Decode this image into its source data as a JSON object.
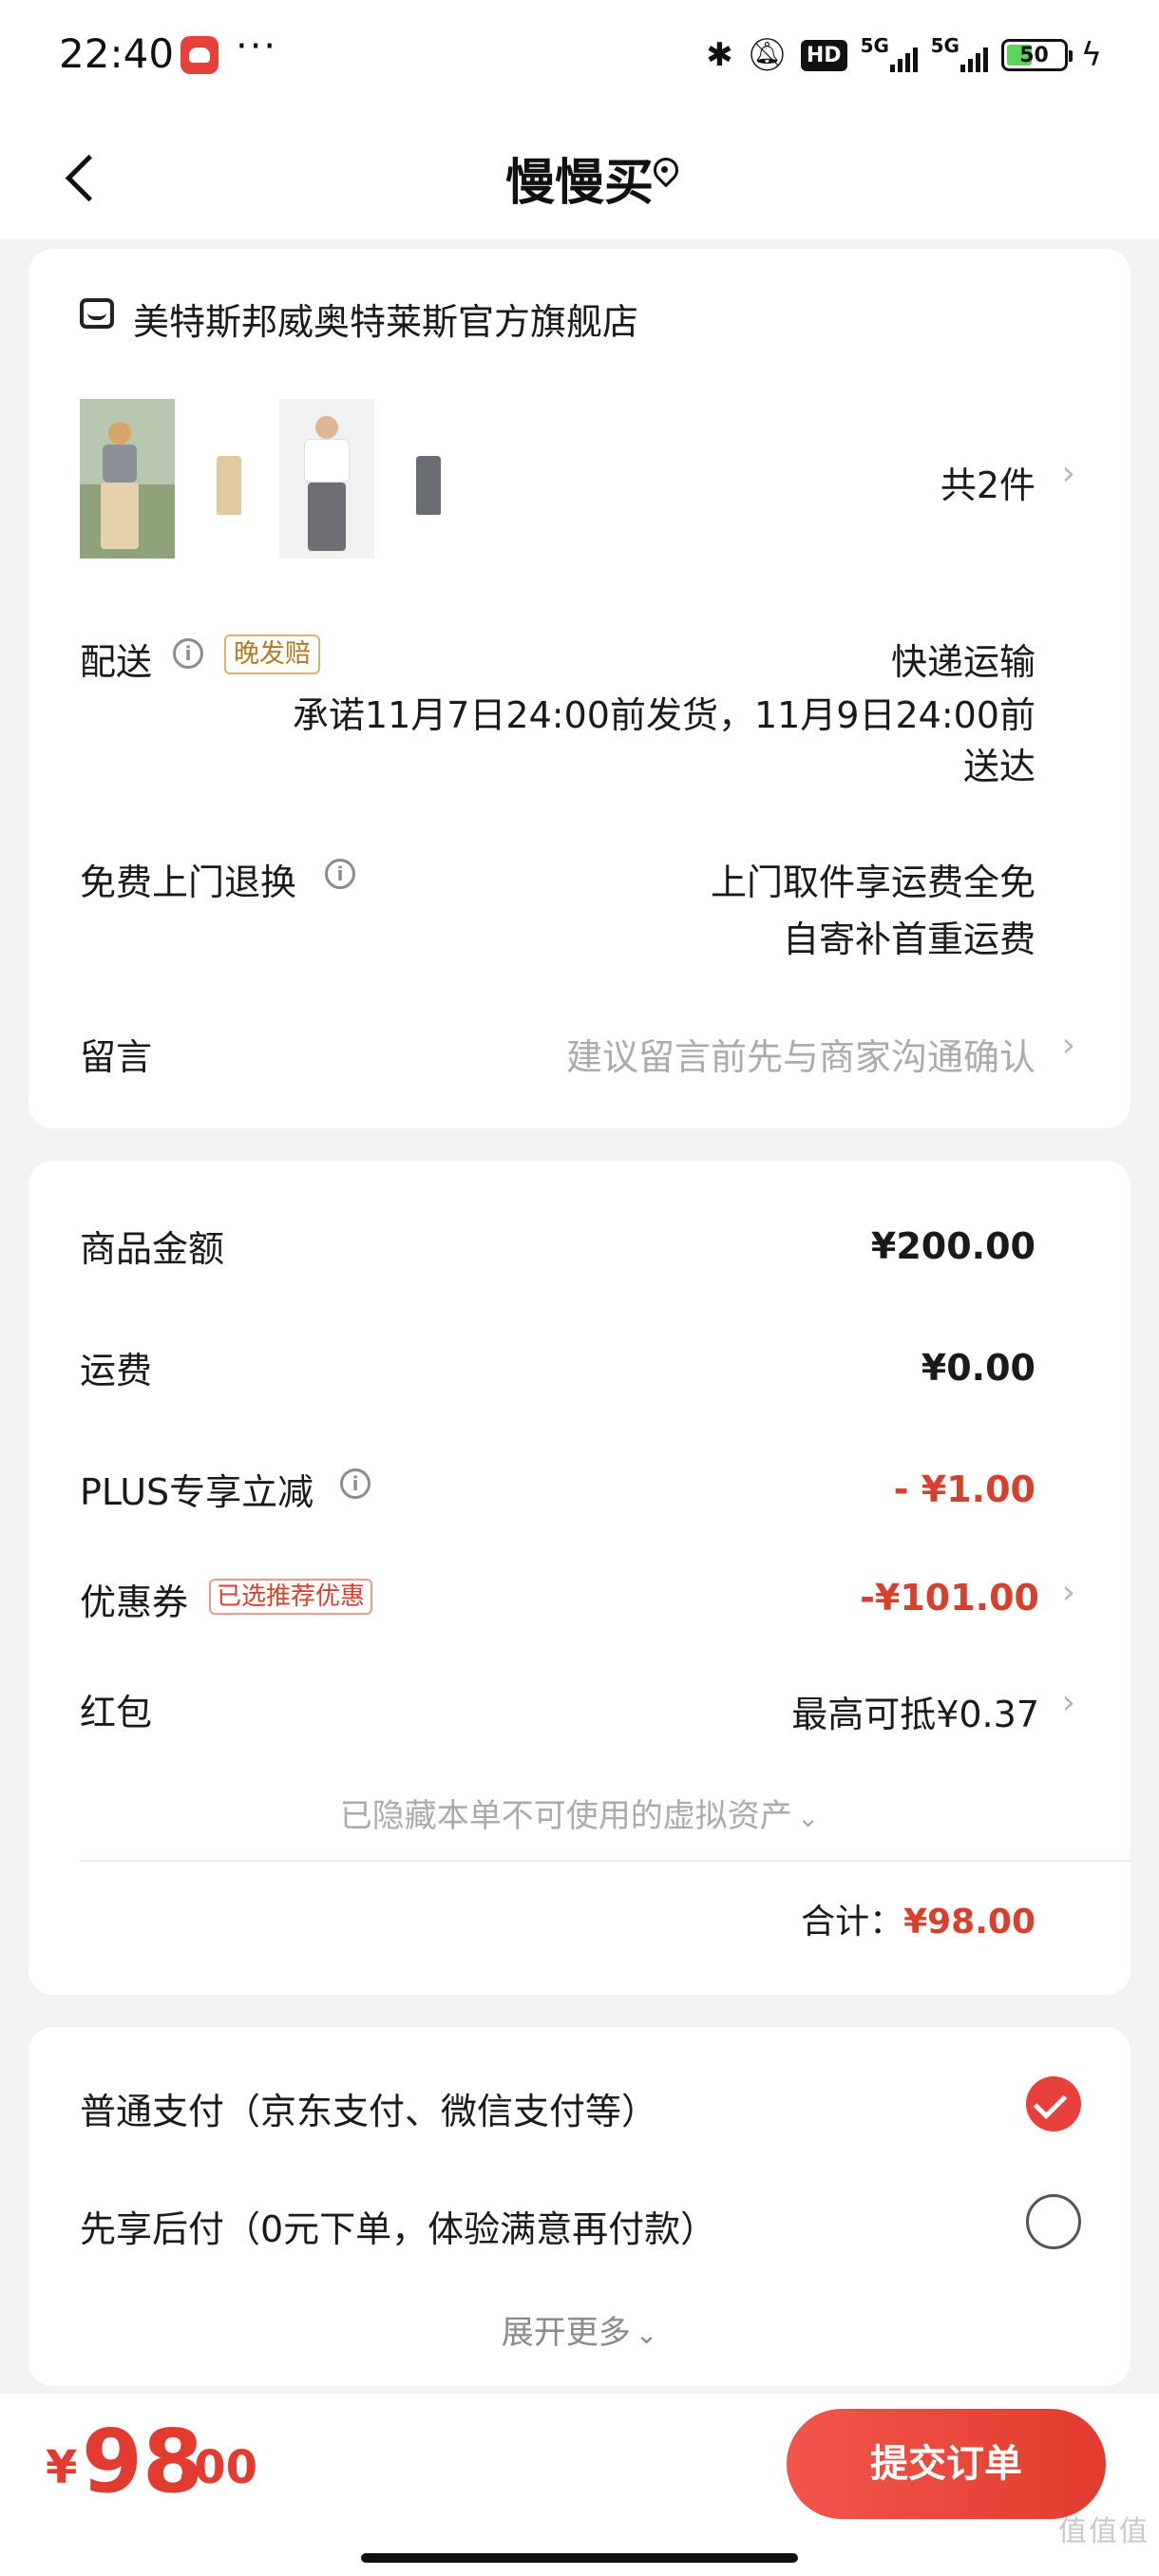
{
  "status_bar": {
    "time": "22:40",
    "more": "···",
    "icons": [
      "bluetooth-icon",
      "mute-icon",
      "hd-icon",
      "signal-5g-icon",
      "signal-5g-icon",
      "battery-icon",
      "charging-icon"
    ],
    "hd_label": "HD",
    "net1": "5G",
    "net2": "5G",
    "battery": "50",
    "battery_level": 0.5
  },
  "header": {
    "title": "慢慢买"
  },
  "order": {
    "store_name": "美特斯邦威奥特莱斯官方旗舰店",
    "items_count": "共2件",
    "delivery_label": "配送",
    "delivery_badge": "晚发赔",
    "delivery_method": "快递运输",
    "delivery_promise_line1": "承诺11月7日24:00前发货，11月9日24:00前",
    "delivery_promise_line2": "送达",
    "return_label": "免费上门退换",
    "return_line1": "上门取件享运费全免",
    "return_line2": "自寄补首重运费",
    "note_label": "留言",
    "note_placeholder": "建议留言前先与商家沟通确认"
  },
  "price": {
    "goods_label": "商品金额",
    "goods_value": "¥200.00",
    "shipping_label": "运费",
    "shipping_value": "¥0.00",
    "plus_label": "PLUS专享立减",
    "plus_value": "- ¥1.00",
    "coupon_label": "优惠券",
    "coupon_badge": "已选推荐优惠",
    "coupon_value": "-¥101.00",
    "redpacket_label": "红包",
    "redpacket_value": "最高可抵¥0.37",
    "hidden_assets": "已隐藏本单不可使用的虚拟资产",
    "total_label": "合计：",
    "total_value": "¥98.00"
  },
  "payment": {
    "option1": "普通支付（京东支付、微信支付等）",
    "option2": "先享后付（0元下单，体验满意再付款）",
    "expand_more": "展开更多"
  },
  "bottom": {
    "currency": "¥",
    "total_int": "98",
    "total_dec": ".00",
    "submit": "提交订单",
    "watermark": "值值值"
  },
  "colors": {
    "accent": "#e23b2f",
    "badge_gold": "#b07a22",
    "muted": "#ababab"
  }
}
